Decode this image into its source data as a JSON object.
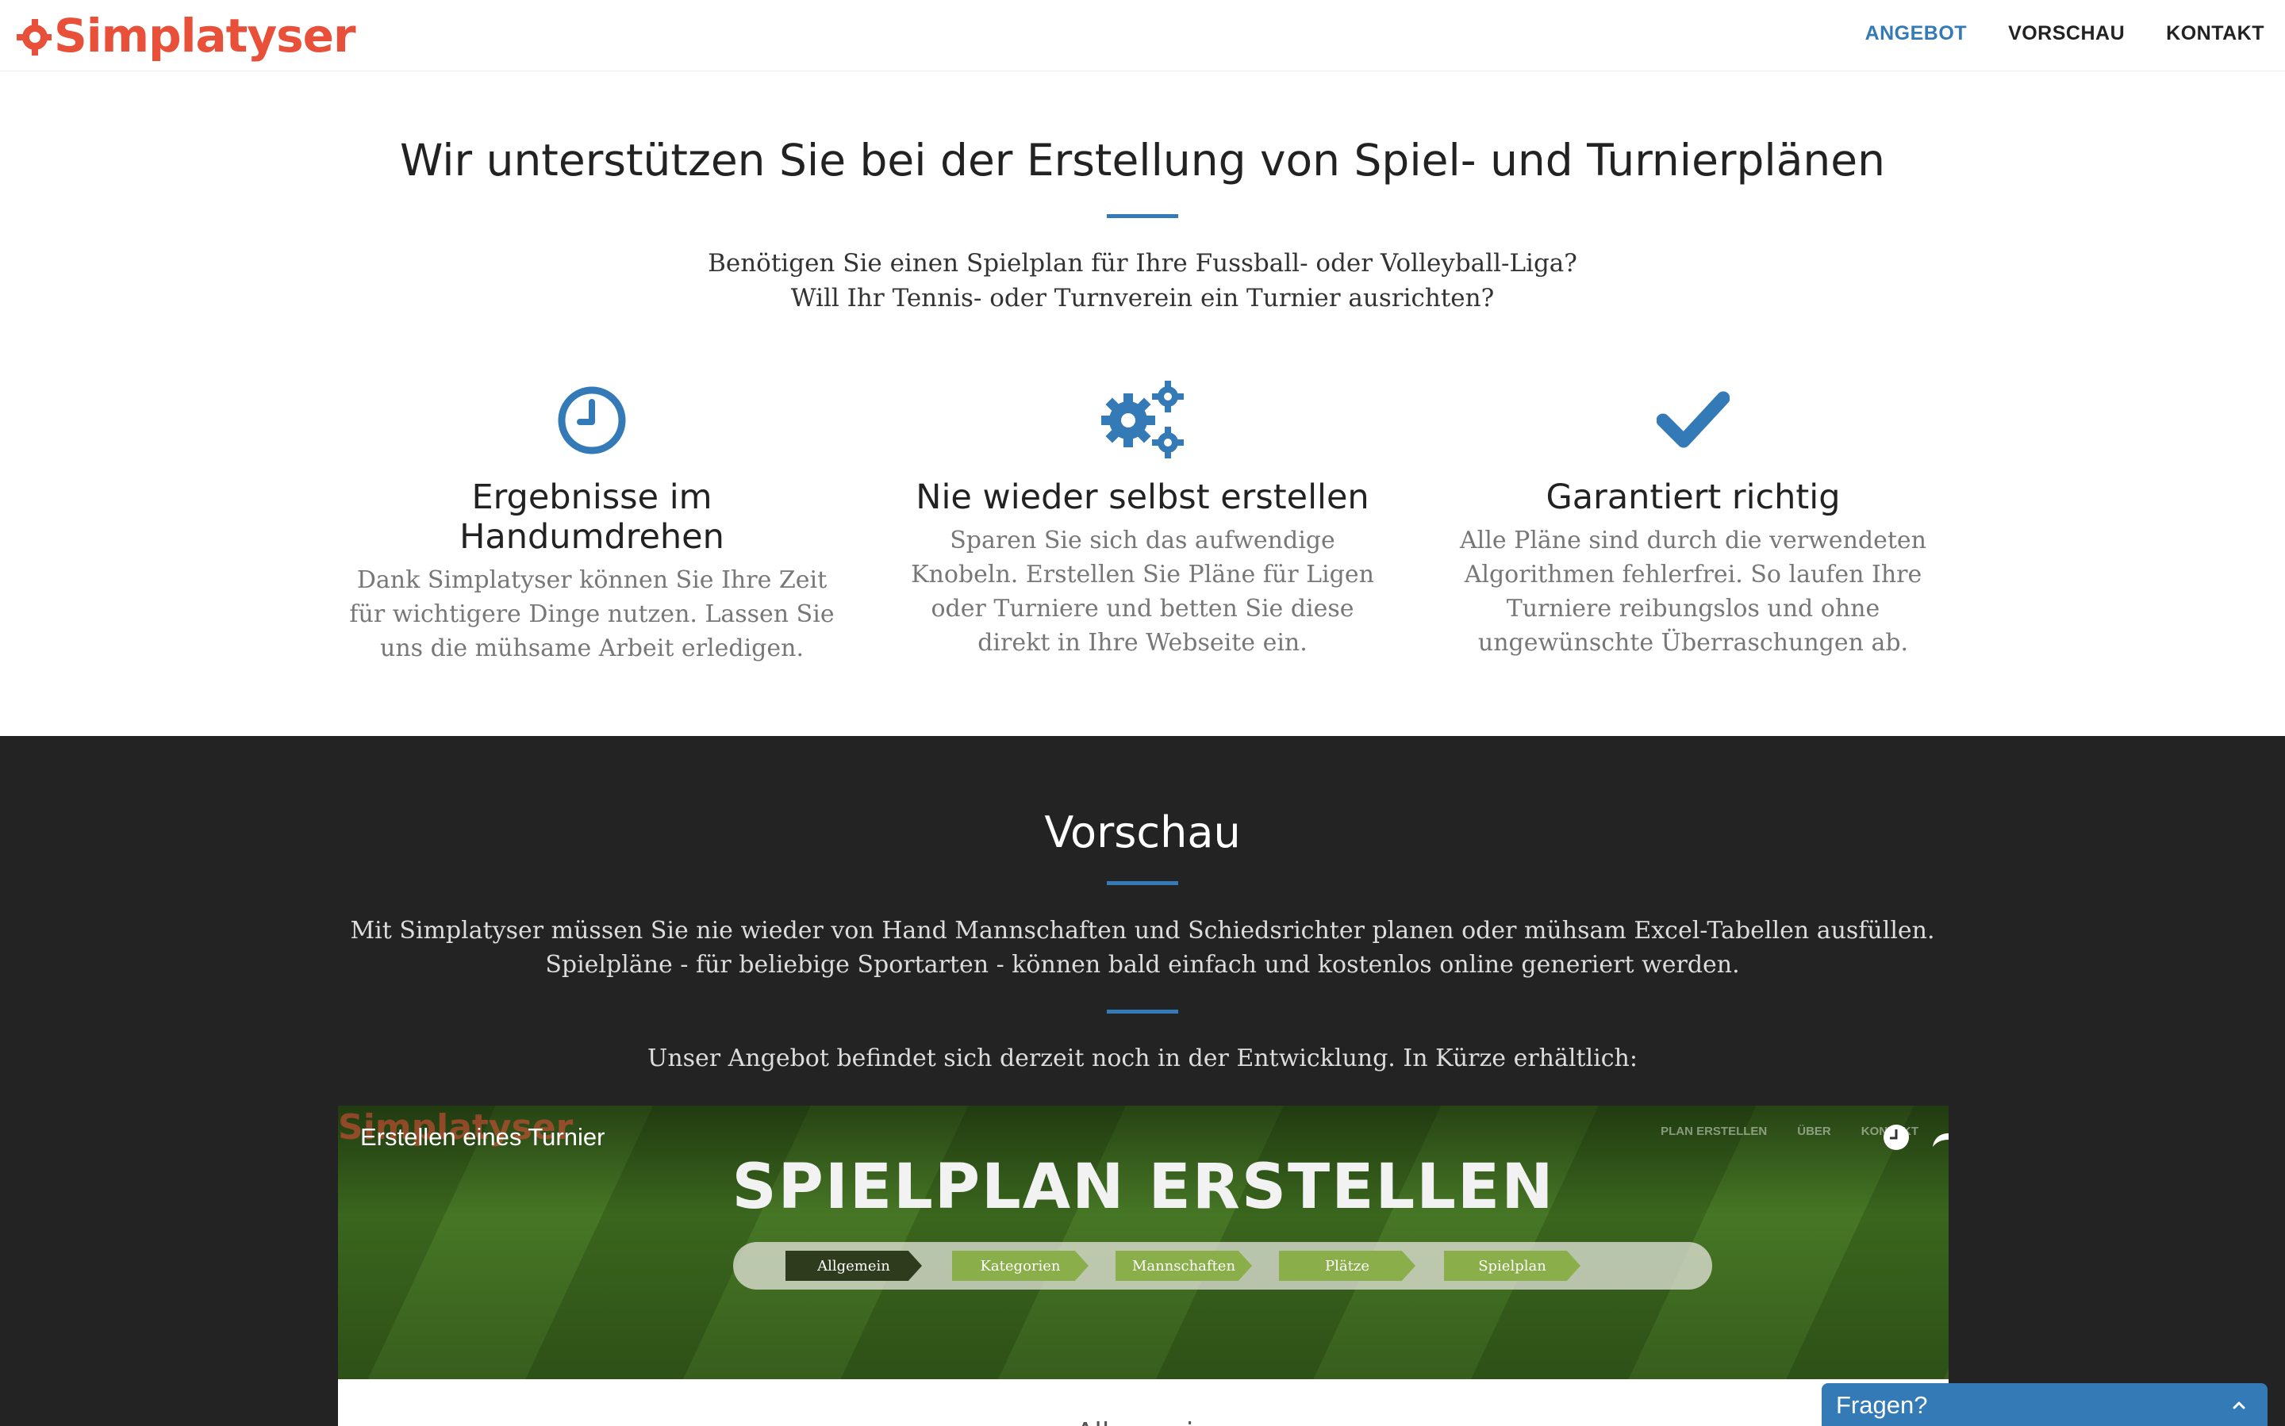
{
  "brand": {
    "name": "Simplatyser",
    "color": "#e8503a"
  },
  "nav": {
    "items": [
      {
        "label": "ANGEBOT",
        "active": true
      },
      {
        "label": "VORSCHAU",
        "active": false
      },
      {
        "label": "KONTAKT",
        "active": false
      }
    ]
  },
  "intro": {
    "title": "Wir unterstützen Sie bei der Erstellung von Spiel- und Turnierplänen",
    "lead_line1": "Benötigen Sie einen Spielplan für Ihre Fussball- oder Volleyball-Liga?",
    "lead_line2": "Will Ihr Tennis- oder Turnverein ein Turnier ausrichten?"
  },
  "features": [
    {
      "icon": "clock-icon",
      "title": "Ergebnisse im Handumdrehen",
      "text": "Dank Simplatyser können Sie Ihre Zeit für wichtigere Dinge nutzen. Lassen Sie uns die mühsame Arbeit erledigen."
    },
    {
      "icon": "gears-icon",
      "title": "Nie wieder selbst erstellen",
      "text": "Sparen Sie sich das aufwendige Knobeln. Erstellen Sie Pläne für Ligen oder Turniere und betten Sie diese direkt in Ihre Webseite ein."
    },
    {
      "icon": "checkmark-icon",
      "title": "Garantiert richtig",
      "text": "Alle Pläne sind durch die verwendeten Algorithmen fehlerfrei. So laufen Ihre Turniere reibungslos und ohne ungewünschte Überraschungen ab."
    }
  ],
  "preview": {
    "title": "Vorschau",
    "text_line1": "Mit Simplatyser müssen Sie nie wieder von Hand Mannschaften und Schiedsrichter planen oder mühsam Excel-Tabellen ausfüllen.",
    "text_line2": "Spielpläne - für beliebige Sportarten - können bald einfach und kostenlos online generiert werden.",
    "notice": "Unser Angebot befindet sich derzeit noch in der Entwicklung. In Kürze erhältlich:"
  },
  "video": {
    "title": "Erstellen eines Turnier",
    "logo_text": "Simplatyser",
    "nav_items": [
      "PLAN ERSTELLEN",
      "ÜBER",
      "KONTAKT"
    ],
    "heading": "SPIELPLAN ERSTELLEN",
    "steps": [
      "Allgemein",
      "Kategorien",
      "Mannschaften",
      "Plätze",
      "Spielplan"
    ],
    "section_label": "Allgemein"
  },
  "chat": {
    "label": "Fragen?"
  },
  "colors": {
    "accent": "#337ab7",
    "dark_bg": "#232323"
  }
}
